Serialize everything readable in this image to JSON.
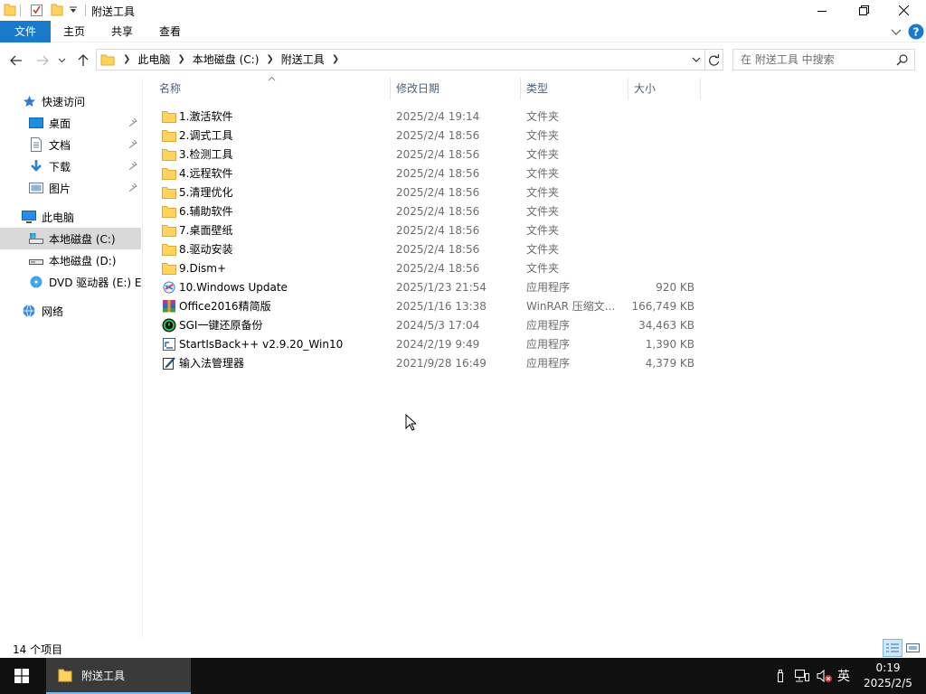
{
  "window": {
    "title": "附送工具",
    "controls": {
      "minimize": "minimize-icon",
      "maximize": "restore-icon",
      "close": "close-icon"
    }
  },
  "ribbon": {
    "tabs": [
      {
        "label": "文件",
        "active": true
      },
      {
        "label": "主页"
      },
      {
        "label": "共享"
      },
      {
        "label": "查看"
      }
    ]
  },
  "address": {
    "crumbs": [
      "此电脑",
      "本地磁盘 (C:)",
      "附送工具"
    ]
  },
  "search": {
    "placeholder": "在 附送工具 中搜索"
  },
  "sidebar": {
    "quick_access": "快速访问",
    "pinned": [
      {
        "label": "桌面",
        "icon": "desktop-icon"
      },
      {
        "label": "文档",
        "icon": "documents-icon"
      },
      {
        "label": "下载",
        "icon": "downloads-icon"
      },
      {
        "label": "图片",
        "icon": "pictures-icon"
      }
    ],
    "this_pc": "此电脑",
    "drives": [
      {
        "label": "本地磁盘 (C:)",
        "selected": true
      },
      {
        "label": "本地磁盘 (D:)"
      },
      {
        "label": "DVD 驱动器 (E:) EA"
      }
    ],
    "network": "网络"
  },
  "columns": {
    "name": "名称",
    "date": "修改日期",
    "type": "类型",
    "size": "大小"
  },
  "files": [
    {
      "name": "1.激活软件",
      "date": "2025/2/4 19:14",
      "type": "文件夹",
      "size": "",
      "icon": "folder-icon"
    },
    {
      "name": "2.调式工具",
      "date": "2025/2/4 18:56",
      "type": "文件夹",
      "size": "",
      "icon": "folder-icon"
    },
    {
      "name": "3.检测工具",
      "date": "2025/2/4 18:56",
      "type": "文件夹",
      "size": "",
      "icon": "folder-icon"
    },
    {
      "name": "4.远程软件",
      "date": "2025/2/4 18:56",
      "type": "文件夹",
      "size": "",
      "icon": "folder-icon"
    },
    {
      "name": "5.清理优化",
      "date": "2025/2/4 18:56",
      "type": "文件夹",
      "size": "",
      "icon": "folder-icon"
    },
    {
      "name": "6.辅助软件",
      "date": "2025/2/4 18:56",
      "type": "文件夹",
      "size": "",
      "icon": "folder-icon"
    },
    {
      "name": "7.桌面壁纸",
      "date": "2025/2/4 18:56",
      "type": "文件夹",
      "size": "",
      "icon": "folder-icon"
    },
    {
      "name": "8.驱动安装",
      "date": "2025/2/4 18:56",
      "type": "文件夹",
      "size": "",
      "icon": "folder-icon"
    },
    {
      "name": "9.Dism+",
      "date": "2025/2/4 18:56",
      "type": "文件夹",
      "size": "",
      "icon": "folder-icon"
    },
    {
      "name": "10.Windows Update",
      "date": "2025/1/23 21:54",
      "type": "应用程序",
      "size": "920 KB",
      "icon": "windows-update-icon"
    },
    {
      "name": "Office2016精简版",
      "date": "2025/1/16 13:38",
      "type": "WinRAR 压缩文...",
      "size": "166,749 KB",
      "icon": "winrar-icon"
    },
    {
      "name": "SGI一键还原备份",
      "date": "2024/5/3 17:04",
      "type": "应用程序",
      "size": "34,463 KB",
      "icon": "sgi-icon"
    },
    {
      "name": "StartIsBack++ v2.9.20_Win10",
      "date": "2024/2/19 9:49",
      "type": "应用程序",
      "size": "1,390 KB",
      "icon": "installer-icon"
    },
    {
      "name": "输入法管理器",
      "date": "2021/9/28 16:49",
      "type": "应用程序",
      "size": "4,379 KB",
      "icon": "ime-manager-icon"
    }
  ],
  "status": {
    "count": "14 个项目"
  },
  "taskbar": {
    "window_label": "附送工具",
    "ime": "英",
    "time": "0:19",
    "date": "2025/2/5"
  },
  "colors": {
    "accent": "#1979ca",
    "selection": "#cce8ff",
    "taskbar": "#101010"
  }
}
